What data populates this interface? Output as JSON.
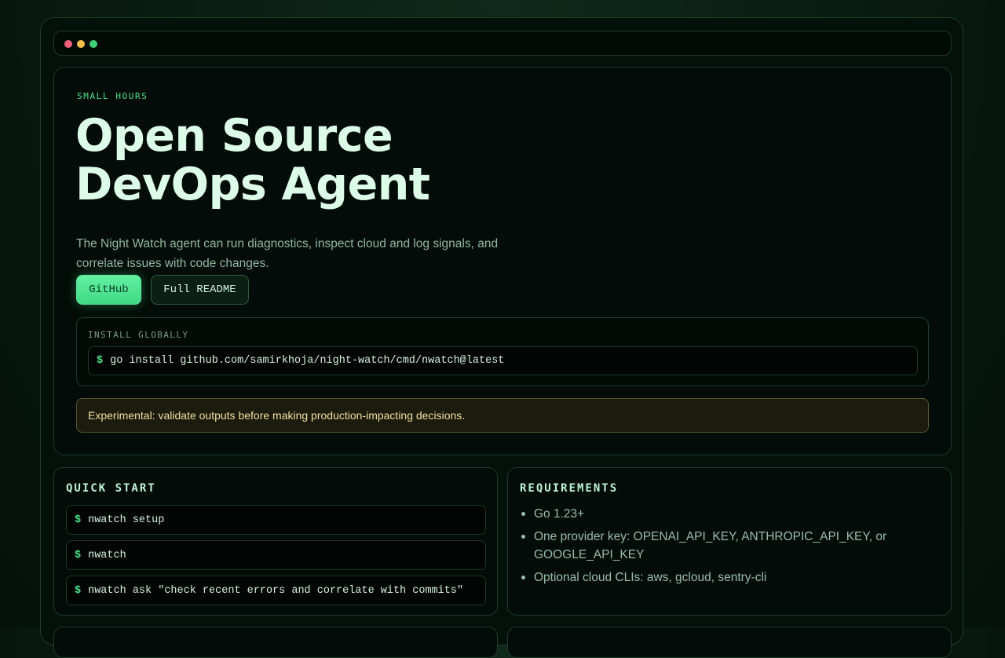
{
  "hero": {
    "eyebrow": "SMALL HOURS",
    "title_line1": "Open Source",
    "title_line2": "DevOps Agent",
    "description": "The Night Watch agent can run diagnostics, inspect cloud and log signals, and correlate issues with code changes.",
    "github_label": "GitHub",
    "readme_label": "Full README"
  },
  "install": {
    "label": "INSTALL GLOBALLY",
    "prompt": "$",
    "command": "go install github.com/samirkhoja/night-watch/cmd/nwatch@latest"
  },
  "warning": {
    "text": "Experimental: validate outputs before making production-impacting decisions."
  },
  "quick_start": {
    "title": "QUICK START",
    "commands": [
      {
        "prompt": "$",
        "text": "nwatch setup"
      },
      {
        "prompt": "$",
        "text": "nwatch"
      },
      {
        "prompt": "$",
        "text": "nwatch ask \"check recent errors and correlate with commits\""
      }
    ]
  },
  "requirements": {
    "title": "REQUIREMENTS",
    "items": [
      "Go 1.23+",
      "One provider key: OPENAI_API_KEY, ANTHROPIC_API_KEY, or GOOGLE_API_KEY",
      "Optional cloud CLIs: aws, gcloud, sentry-cli"
    ]
  },
  "colors": {
    "accent": "#4ee08a",
    "background": "#04100a",
    "warning_text": "#f2dfa0"
  }
}
